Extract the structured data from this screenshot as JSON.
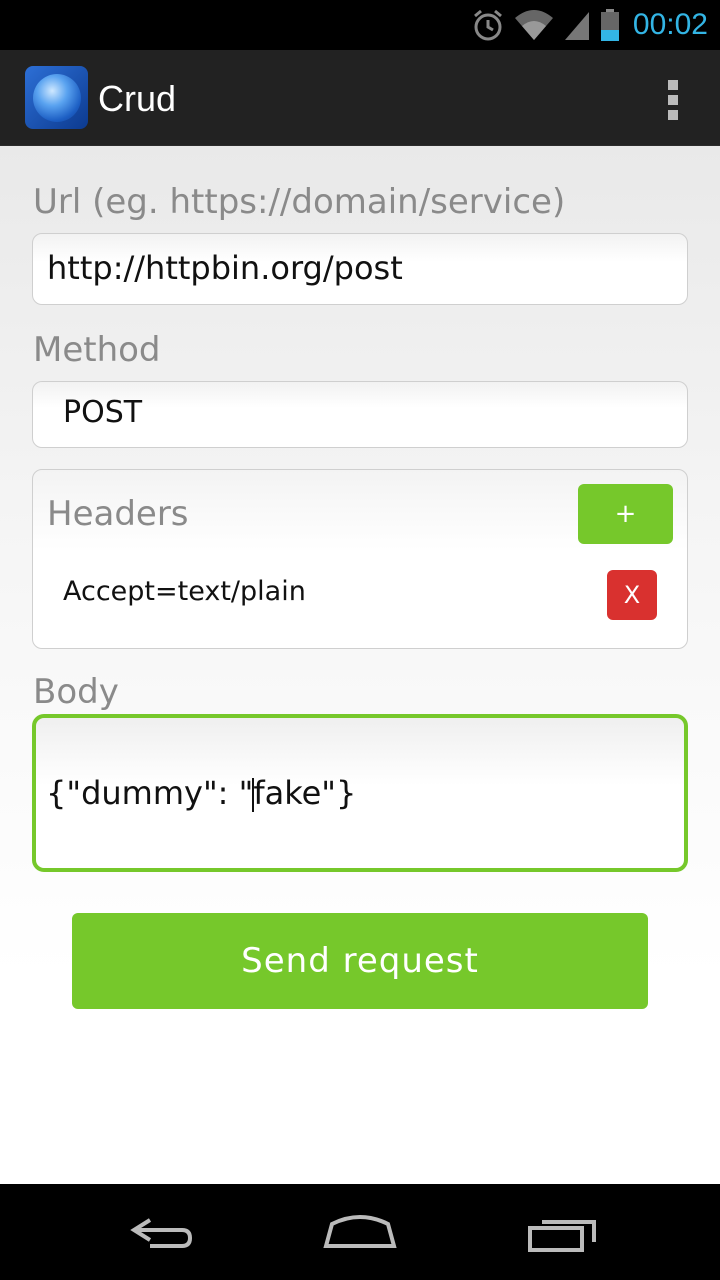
{
  "status_bar": {
    "time": "00:02",
    "icons": [
      "alarm-icon",
      "wifi-icon",
      "signal-icon",
      "battery-icon"
    ],
    "accent": "#33b5e5"
  },
  "action_bar": {
    "title": "Crud",
    "menu_icon": "overflow-menu-icon"
  },
  "form": {
    "url_label": "Url (eg. https://domain/service)",
    "url_value": "http://httpbin.org/post",
    "method_label": "Method",
    "method_value": "POST",
    "headers_label": "Headers",
    "add_header_label": "+",
    "headers": [
      {
        "text": "Accept=text/plain",
        "remove_label": "X"
      }
    ],
    "body_label": "Body",
    "body_before_cursor": "{\"dummy\": \"",
    "body_after_cursor": "fake\"}",
    "send_label": "Send request"
  },
  "colors": {
    "primary_green": "#76c82b",
    "danger_red": "#d9312f",
    "actionbar": "#222222"
  },
  "nav_bar": {
    "buttons": [
      "back-icon",
      "home-icon",
      "recents-icon"
    ]
  }
}
